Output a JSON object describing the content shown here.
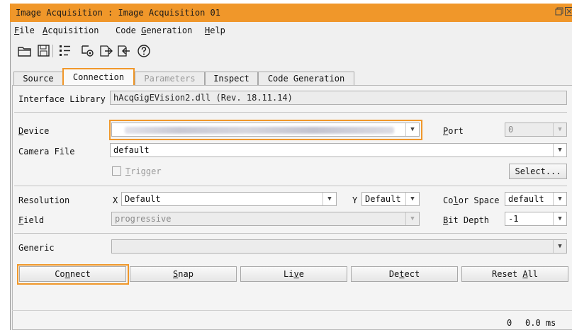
{
  "window": {
    "title": "Image Acquisition : Image Acquisition 01",
    "restore_icon": "restore-window-icon",
    "close_icon": "close-icon"
  },
  "menu": [
    {
      "pre": "",
      "u": "F",
      "post": "ile"
    },
    {
      "pre": "",
      "u": "A",
      "post": "cquisition"
    },
    {
      "pre": "Code ",
      "u": "G",
      "post": "eneration"
    },
    {
      "pre": "",
      "u": "H",
      "post": "elp"
    }
  ],
  "toolbar": [
    "open-folder-icon",
    "save-icon",
    "list-icon",
    "settings-icon",
    "export-icon",
    "import-icon",
    "help-icon"
  ],
  "tabs": [
    {
      "label": "Source"
    },
    {
      "label": "Connection"
    },
    {
      "label": "Parameters"
    },
    {
      "label": "Inspect"
    },
    {
      "label": "Code Generation"
    }
  ],
  "form": {
    "interface_library_label": "Interface Library",
    "interface_library_value": "hAcqGigEVision2.dll (Rev. 18.11.14)",
    "device_label_u": "D",
    "device_label_rest": "evice",
    "port_label_u": "P",
    "port_label_rest": "ort",
    "port_value": "0",
    "camera_file_label": "Camera File",
    "camera_file_value": "default",
    "trigger_u": "T",
    "trigger_rest": "rigger",
    "select_button": "Select...",
    "resolution_label": "Resolution",
    "x_label": "X",
    "x_value": "Default",
    "y_label": "Y",
    "y_value": "Default",
    "color_space_pre": "Co",
    "color_space_u": "l",
    "color_space_post": "or Space",
    "color_space_value": "default",
    "field_label_u": "F",
    "field_label_rest": "ield",
    "field_value": "progressive",
    "bit_depth_u": "B",
    "bit_depth_rest": "it Depth",
    "bit_depth_value": "-1",
    "generic_label": "Generic",
    "generic_value": ""
  },
  "buttons": {
    "connect": {
      "pre": "Co",
      "u": "n",
      "post": "nect"
    },
    "snap": {
      "pre": "",
      "u": "S",
      "post": "nap"
    },
    "live": {
      "pre": "Li",
      "u": "v",
      "post": "e"
    },
    "detect": {
      "pre": "De",
      "u": "t",
      "post": "ect"
    },
    "reset_all": {
      "pre": "Reset ",
      "u": "A",
      "post": "ll"
    }
  },
  "status": {
    "frame_count": "0",
    "time": "0.0 ms"
  }
}
